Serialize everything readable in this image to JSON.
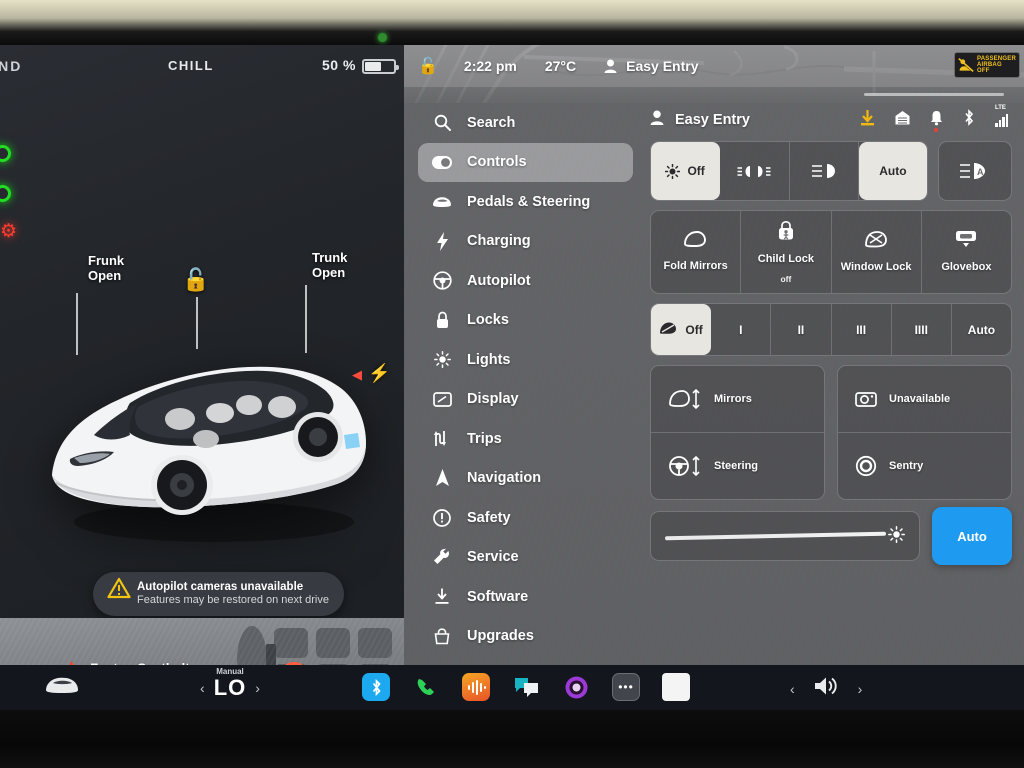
{
  "left_pane": {
    "gear": "RND",
    "drive_mode": "CHILL",
    "battery_percent": "50 %",
    "battery_level": 52,
    "callouts": [
      {
        "name": "frunk",
        "line1": "Frunk",
        "line2": "Open"
      },
      {
        "name": "trunk",
        "line1": "Trunk",
        "line2": "Open"
      }
    ],
    "unlock_icon": "unlock-icon",
    "toast": {
      "title": "Autopilot cameras unavailable",
      "subtitle": "Features may be restored on next drive",
      "icon": "warning-triangle-icon"
    },
    "seatbelt_warning": {
      "label": "Fasten Seatbelt",
      "icon": "seatbelt-warning-icon"
    },
    "indicators": [
      "green-ring-indicator",
      "green-ring-indicator",
      "red-brake-indicator"
    ]
  },
  "right_pane": {
    "top_bar": {
      "lock_icon": "unlock-icon",
      "time": "2:22 pm",
      "temperature": "27°C",
      "profile_icon": "person-icon",
      "profile": "Easy Entry",
      "airbag_line1": "PASSENGER",
      "airbag_line2": "AIRBAG OFF"
    },
    "menu": [
      {
        "icon": "search-icon",
        "label": "Search",
        "selected": false
      },
      {
        "icon": "toggle-icon",
        "label": "Controls",
        "selected": true
      },
      {
        "icon": "car-icon",
        "label": "Pedals & Steering",
        "selected": false
      },
      {
        "icon": "bolt-icon",
        "label": "Charging",
        "selected": false
      },
      {
        "icon": "steering-icon",
        "label": "Autopilot",
        "selected": false
      },
      {
        "icon": "lock-icon",
        "label": "Locks",
        "selected": false
      },
      {
        "icon": "sun-icon",
        "label": "Lights",
        "selected": false
      },
      {
        "icon": "display-icon",
        "label": "Display",
        "selected": false
      },
      {
        "icon": "trips-icon",
        "label": "Trips",
        "selected": false
      },
      {
        "icon": "nav-icon",
        "label": "Navigation",
        "selected": false
      },
      {
        "icon": "safety-icon",
        "label": "Safety",
        "selected": false
      },
      {
        "icon": "wrench-icon",
        "label": "Service",
        "selected": false
      },
      {
        "icon": "download-icon",
        "label": "Software",
        "selected": false
      },
      {
        "icon": "upgrade-icon",
        "label": "Upgrades",
        "selected": false
      }
    ],
    "panel_header": {
      "icon": "person-icon",
      "title": "Easy Entry",
      "status_icons": [
        "software-download-icon",
        "garage-door-icon",
        "notification-bell-icon",
        "bluetooth-icon",
        "lte-signal-icon"
      ],
      "lte_label": "LTE"
    },
    "lights_row": [
      {
        "label": "Off",
        "icon": "headlight-off-icon",
        "selected": false
      },
      {
        "label": "",
        "icon": "parking-lights-icon",
        "selected": false
      },
      {
        "label": "",
        "icon": "low-beam-icon",
        "selected": false
      },
      {
        "label": "Auto",
        "icon": "",
        "selected": true
      }
    ],
    "auto_highbeam": {
      "label": "",
      "icon": "auto-high-beam-icon",
      "selected": false
    },
    "tiles_row": [
      {
        "label": "Fold Mirrors",
        "sub": "",
        "icon": "mirror-icon"
      },
      {
        "label": "Child Lock",
        "sub": "off",
        "icon": "child-lock-icon"
      },
      {
        "label": "Window Lock",
        "sub": "",
        "icon": "window-lock-icon"
      },
      {
        "label": "Glovebox",
        "sub": "",
        "icon": "glovebox-icon"
      }
    ],
    "wiper_row": [
      {
        "label": "Off",
        "icon": "wiper-icon",
        "selected": true
      },
      {
        "label": "I",
        "icon": "",
        "selected": false
      },
      {
        "label": "II",
        "icon": "",
        "selected": false
      },
      {
        "label": "III",
        "icon": "",
        "selected": false
      },
      {
        "label": "IIII",
        "icon": "",
        "selected": false
      },
      {
        "label": "Auto",
        "icon": "",
        "selected": false
      }
    ],
    "adjust_left": [
      {
        "label": "Mirrors",
        "icon": "mirror-adjust-icon"
      },
      {
        "label": "Steering",
        "icon": "steering-adjust-icon"
      }
    ],
    "adjust_right": [
      {
        "label": "Unavailable",
        "icon": "camera-icon"
      },
      {
        "label": "Sentry",
        "icon": "sentry-icon"
      }
    ],
    "brightness": {
      "icon": "brightness-sun-icon",
      "value": 92,
      "auto_label": "Auto",
      "auto_color": "#1e9bf0"
    }
  },
  "dock": {
    "car_icon": "car-front-icon",
    "climate": {
      "mode": "Manual",
      "temperature": "LO",
      "prev_icon": "chevron-left-icon",
      "next_icon": "chevron-right-icon"
    },
    "apps": [
      {
        "name": "bluetooth-app-icon",
        "glyph": "ᛗ",
        "color": "#1ca9f0"
      },
      {
        "name": "phone-app-icon",
        "glyph": "✆",
        "color": "transparent"
      },
      {
        "name": "media-app-icon",
        "glyph": "",
        "color": "#f2952c"
      },
      {
        "name": "messages-app-icon",
        "glyph": "",
        "color": "transparent"
      },
      {
        "name": "voice-app-icon",
        "glyph": "",
        "color": "transparent"
      },
      {
        "name": "more-apps-icon",
        "glyph": "•••",
        "color": "#44464c"
      },
      {
        "name": "blank-app-icon",
        "glyph": "",
        "color": "#f2f2f2"
      }
    ],
    "volume": {
      "prev_icon": "chevron-left-icon",
      "speaker_icon": "speaker-icon",
      "next_icon": "chevron-right-icon"
    }
  }
}
